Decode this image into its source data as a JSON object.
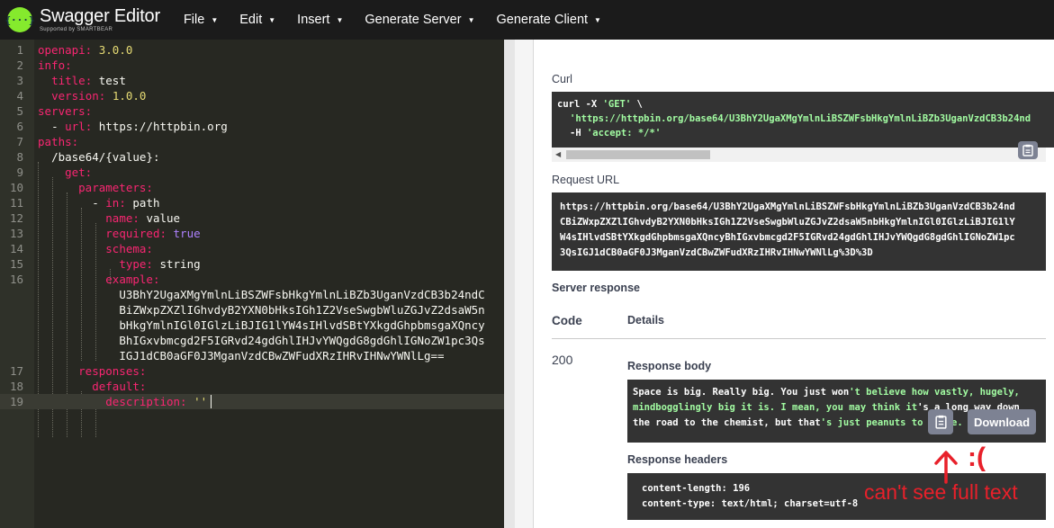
{
  "app": {
    "title": "Swagger Editor",
    "subtitle": "Supported by SMARTBEAR",
    "logo_glyph": "{···}"
  },
  "menu": [
    {
      "label": "File"
    },
    {
      "label": "Edit"
    },
    {
      "label": "Insert"
    },
    {
      "label": "Generate Server"
    },
    {
      "label": "Generate Client"
    }
  ],
  "editor": {
    "lines": [
      {
        "num": "1"
      },
      {
        "num": "2"
      },
      {
        "num": "3"
      },
      {
        "num": "4"
      },
      {
        "num": "5"
      },
      {
        "num": "6"
      },
      {
        "num": "7"
      },
      {
        "num": "8"
      },
      {
        "num": "9"
      },
      {
        "num": "10"
      },
      {
        "num": "11"
      },
      {
        "num": "12"
      },
      {
        "num": "13"
      },
      {
        "num": "14"
      },
      {
        "num": "15"
      },
      {
        "num": "16"
      },
      {
        "num": "17"
      },
      {
        "num": "18"
      },
      {
        "num": "19"
      }
    ],
    "tokens": {
      "openapi_key": "openapi:",
      "openapi_val": "3.0.0",
      "info_key": "info:",
      "title_key": "title:",
      "title_val": "test",
      "version_key": "version:",
      "version_val": "1.0.0",
      "servers_key": "servers:",
      "url_dash": "- ",
      "url_key": "url:",
      "url_val": "https://httpbin.org",
      "paths_key": "paths:",
      "path_val": "/base64/{value}:",
      "get_key": "get:",
      "parameters_key": "parameters:",
      "in_dash": "- ",
      "in_key": "in:",
      "in_val": "path",
      "name_key": "name:",
      "name_val": "value",
      "required_key": "required:",
      "required_val": "true",
      "schema_key": "schema:",
      "type_key": "type:",
      "type_val": "string",
      "example_key": "example:",
      "example_wrap": [
        "U3BhY2UgaXMgYmlnLiBSZWFsbHkgYmlnLiBZb3UganVzdCB3b24ndC",
        "BiZWxpZXZlIGhvdyB2YXN0bHksIGh1Z2VseSwgbWluZGJvZ2dsaW5n",
        "bHkgYmlnIGl0IGlzLiBJIG1lYW4sIHlvdSBtYXkgdGhpbmsgaXQncy",
        "BhIGxvbmcgd2F5IGRvd24gdGhlIHJvYWQgdG8gdGhlIGNoZW1pc3Qs",
        "IGJ1dCB0aGF0J3MganVzdCBwZWFudXRzIHRvIHNwYWNlLg=="
      ],
      "responses_key": "responses:",
      "default_key": "default:",
      "description_key": "description:",
      "description_val": "''"
    }
  },
  "response_panel": {
    "curl_label": "Curl",
    "curl_lines": {
      "l1_cmd": "curl -X ",
      "l1_method": "'GET'",
      "l1_tail": " \\",
      "l2_url": "'https://httpbin.org/base64/U3BhY2UgaXMgYmlnLiBSZWFsbHkgYmlnLiBZb3UganVzdCB3b24nd",
      "l3_flag": "-H ",
      "l3_header": "'accept: */*'"
    },
    "request_url_label": "Request URL",
    "request_url_lines": [
      "https://httpbin.org/base64/U3BhY2UgaXMgYmlnLiBSZWFsbHkgYmlnLiBZb3UganVzdCB3b24nd",
      "CBiZWxpZXZlIGhvdyB2YXN0bHksIGh1Z2VseSwgbWluZGJvZ2dsaW5nbHkgYmlnIGl0IGlzLiBJIG1lY",
      "W4sIHlvdSBtYXkgdGhpbmsgaXQncyBhIGxvbmcgd2F5IGRvd24gdGhlIHJvYWQgdG8gdGhlIGNoZW1pc",
      "3QsIGJ1dCB0aGF0J3MganVzdCBwZWFudXRzIHRvIHNwYWNlLg%3D%3D"
    ],
    "server_response_label": "Server response",
    "code_header": "Code",
    "details_header": "Details",
    "code_value": "200",
    "response_body_label": "Response body",
    "response_body": {
      "l1_white": "Space is big. Really big. You just won",
      "l1_green": "'t believe how vastly, hugely,",
      "l2_green": "mindbogglingly big it is. I mean, you may think it",
      "l2_white": "'s a long way down",
      "l3_white": "the road to the chemist, but that",
      "l3_green": "'s just peanuts to space.",
      "l3_tail": ""
    },
    "download_label": "Download",
    "response_headers_label": "Response headers",
    "response_headers": [
      "content-length: 196",
      "content-type: text/html; charset=utf-8"
    ]
  },
  "annotation": {
    "face": ":(",
    "note": "can't see full text",
    "color": "#e8202a"
  },
  "colors": {
    "topbar": "#1b1b1b",
    "logo_green": "#85ea2d",
    "editor_bg": "#272822",
    "key_pink": "#f92672",
    "value_yellow": "#e6db74",
    "number_purple": "#ae81ff",
    "codebox_bg": "#333333",
    "string_green": "#a2fca2"
  }
}
